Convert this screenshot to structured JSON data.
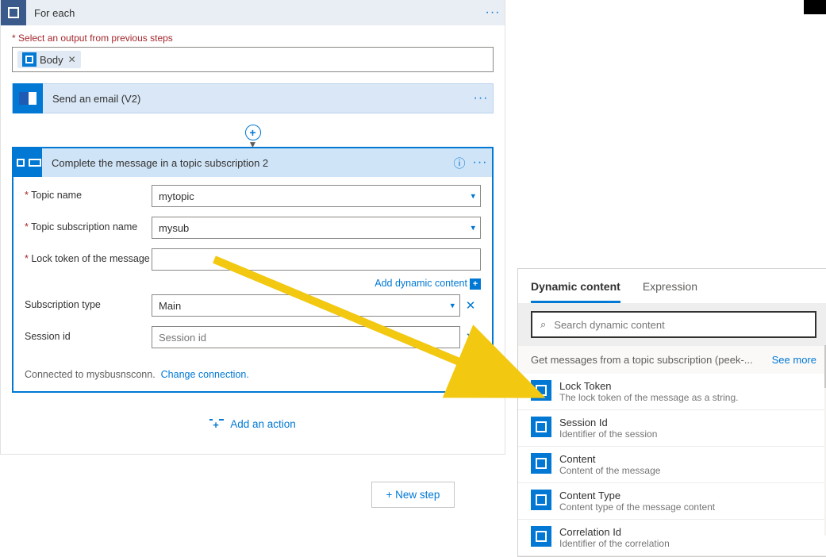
{
  "foreach": {
    "title": "For each",
    "select_label": "Select an output from previous steps",
    "body_token": "Body"
  },
  "send_email": {
    "title": "Send an email (V2)"
  },
  "complete": {
    "title": "Complete the message in a topic subscription 2",
    "fields": {
      "topic_label": "Topic name",
      "topic_value": "mytopic",
      "sub_label": "Topic subscription name",
      "sub_value": "mysub",
      "lock_label": "Lock token of the message",
      "lock_value": "",
      "subtype_label": "Subscription type",
      "subtype_value": "Main",
      "session_label": "Session id",
      "session_placeholder": "Session id"
    },
    "dyn_link": "Add dynamic content",
    "connection_text": "Connected to mysbusnsconn.",
    "change_conn": "Change connection."
  },
  "add_action": "Add an action",
  "new_step": "+ New step",
  "panel": {
    "tab1": "Dynamic content",
    "tab2": "Expression",
    "search_placeholder": "Search dynamic content",
    "section": "Get messages from a topic subscription (peek-...",
    "see_more": "See more",
    "items": [
      {
        "t": "Lock Token",
        "d": "The lock token of the message as a string."
      },
      {
        "t": "Session Id",
        "d": "Identifier of the session"
      },
      {
        "t": "Content",
        "d": "Content of the message"
      },
      {
        "t": "Content Type",
        "d": "Content type of the message content"
      },
      {
        "t": "Correlation Id",
        "d": "Identifier of the correlation"
      }
    ]
  }
}
